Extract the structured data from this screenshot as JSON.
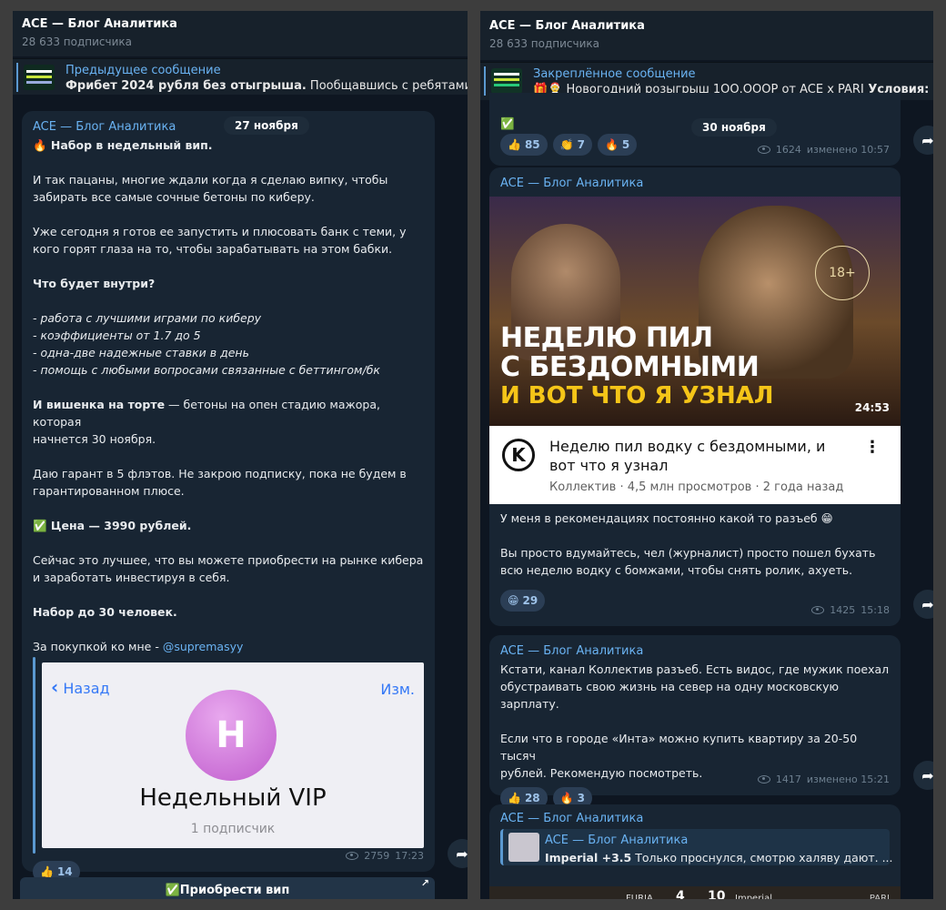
{
  "left": {
    "channel_title": "ACE — Блог Аналитика",
    "subscribers": "28 633 подписчика",
    "pinned": {
      "title": "Предыдущее сообщение",
      "bold_text": "Фрибет 2024 рубля без отыгрыша.",
      "rest_text": " Пообщавшись с ребятами из"
    },
    "message": {
      "author": "ACE — Блог Аналитика",
      "date": "27 ноября",
      "heading": "🔥 Набор в недельный вип.",
      "p1": "И так пацаны, многие ждали когда я сделаю випку, чтобы",
      "p1b": "забирать все самые сочные бетоны по киберу.",
      "p2": "Уже сегодня я готов ее запустить и плюсовать банк с теми, у",
      "p2b": "кого горят глаза на то, чтобы зарабатывать на этом бабки.",
      "p3": "Что будет внутри?",
      "list": [
        "- работа с лучшими играми по киберу",
        "- коэффициенты от 1.7 до 5",
        "- одна-две надежные ставки в день",
        "- помощь с любыми вопросами связанные с беттингом/бк"
      ],
      "p4_bold": "И вишенка на торте",
      "p4_rest": " — бетоны на опен стадию мажора, которая",
      "p4b": "начнется 30 ноября.",
      "p5": "Даю гарант в 5 флэтов. Не закрою подписку, пока не будем в",
      "p5b": "гарантированном плюсе.",
      "p6": "✅ Цена — 3990 рублей.",
      "p7": "Сейчас это лучшее, что вы можете приобрести на рынке кибера",
      "p7b": "и заработать инвестируя в себя.",
      "p8": "Набор до 30 человек.",
      "p9": "За покупкой ко мне - ",
      "p9_link": "@supremasyy",
      "card": {
        "back": "Назад",
        "edit": "Изм.",
        "avatar_letter": "Н",
        "name": "Недельный VIP",
        "subs": "1 подписчик"
      },
      "reaction": {
        "emoji": "👍",
        "count": "14"
      },
      "views": "2759",
      "time": "17:23"
    },
    "button": "✅Приобрести вип"
  },
  "right": {
    "channel_title": "ACE — Блог Аналитика",
    "subscribers": "28 633 подписчика",
    "pinned": {
      "title": "Закреплённое сообщение",
      "text": "🎁🤶 Новогодний розыгрыш 1ОО.ОООР от ACE x PARI",
      "bold_text": " Условия:"
    },
    "msg0": {
      "check": "✅",
      "reactions": [
        {
          "emoji": "👍",
          "count": "85"
        },
        {
          "emoji": "👏",
          "count": "7"
        },
        {
          "emoji": "🔥",
          "count": "5"
        }
      ],
      "date": "30 ноября",
      "views": "1624",
      "time": "изменено 10:57"
    },
    "msg1": {
      "author": "ACE — Блог Аналитика",
      "thumb_line1": "НЕДЕЛЮ ПИЛ",
      "thumb_line2": "С БЕЗДОМНЫМИ",
      "thumb_line3": "И ВОТ ЧТО Я УЗНАЛ",
      "age": "18+",
      "duration": "24:53",
      "yt_logo": "K",
      "yt_title": "Неделю пил водку с бездомными, и",
      "yt_title2": "вот что я узнал",
      "yt_meta": "Коллектив · 4,5 млн просмотров · 2 года назад",
      "yt_more": "⋮",
      "text1": "У меня в рекомендациях постоянно какой то разъеб 😁",
      "text2": "Вы просто вдумайтесь, чел (журналист) просто пошел бухать",
      "text2b": "всю неделю водку с бомжами, чтобы снять ролик, ахуеть.",
      "reaction": {
        "emoji": "😁",
        "count": "29"
      },
      "views": "1425",
      "time": "15:18"
    },
    "msg2": {
      "author": "ACE — Блог Аналитика",
      "t1": "Кстати, канал Коллектив разъеб. Есть видос, где мужик поехал",
      "t2": "обустраивать свою жизнь на север на одну московскую",
      "t3": "зарплату.",
      "t4": "Если что в городе «Инта» можно купить квартиру за 20-50 тысяч",
      "t5": "рублей. Рекомендую посмотреть.",
      "reactions": [
        {
          "emoji": "👍",
          "count": "28"
        },
        {
          "emoji": "🔥",
          "count": "3"
        }
      ],
      "views": "1417",
      "time": "изменено 15:21"
    },
    "msg3": {
      "author": "ACE — Блог Аналитика",
      "quote_author": "ACE — Блог Аналитика",
      "quote_bold": "Imperial +3.5",
      "quote_text": "  Только проснулся, смотрю халяву дают. ...",
      "score_left": "4",
      "score_right": "10",
      "team_left": "FURIA",
      "team_right": "Imperial",
      "brand": "PARI"
    }
  },
  "colors": {
    "bg": "#0e1621",
    "bubble": "#182533",
    "accent": "#6ab3f3",
    "reaction_bg": "#2b3e55",
    "outer": "#3d3d3d"
  },
  "icons": [
    "eye-icon",
    "share-icon",
    "back-chevron-icon",
    "more-vert-icon"
  ]
}
